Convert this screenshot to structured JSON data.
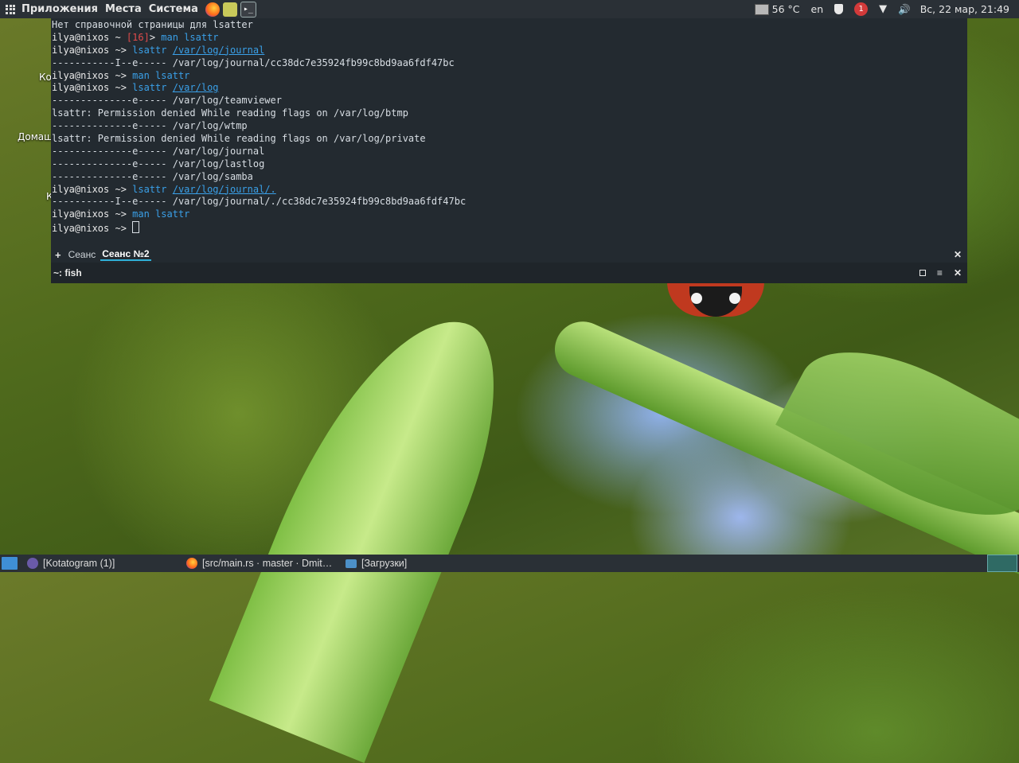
{
  "top_panel": {
    "menus": [
      "Приложения",
      "Места",
      "Система"
    ],
    "temperature": "56 °C",
    "keyboard_layout": "en",
    "notification_count": "1",
    "clock": "Вс, 22 мар, 21:49",
    "terminal_launcher_glyph": "▸_"
  },
  "desktop_labels": [
    "Ко",
    "Домаш",
    "К"
  ],
  "terminal": {
    "lines": [
      {
        "segments": [
          {
            "t": "Нет справочной страницы для lsatter",
            "c": ""
          }
        ]
      },
      {
        "segments": [
          {
            "t": "ilya@nixos ~ ",
            "c": "c-prompt"
          },
          {
            "t": "[16]",
            "c": "c-red"
          },
          {
            "t": "> ",
            "c": "c-prompt"
          },
          {
            "t": "man lsattr",
            "c": "c-cmd"
          }
        ]
      },
      {
        "segments": [
          {
            "t": "ilya@nixos ~> ",
            "c": "c-prompt"
          },
          {
            "t": "lsattr ",
            "c": "c-cmd"
          },
          {
            "t": "/var/log/journal",
            "c": "c-path"
          }
        ]
      },
      {
        "segments": [
          {
            "t": "-----------I--e----- /var/log/journal/cc38dc7e35924fb99c8bd9aa6fdf47bc",
            "c": ""
          }
        ]
      },
      {
        "segments": [
          {
            "t": "ilya@nixos ~> ",
            "c": "c-prompt"
          },
          {
            "t": "man lsattr",
            "c": "c-cmd"
          }
        ]
      },
      {
        "segments": [
          {
            "t": "ilya@nixos ~> ",
            "c": "c-prompt"
          },
          {
            "t": "lsattr ",
            "c": "c-cmd"
          },
          {
            "t": "/var/log",
            "c": "c-path"
          }
        ]
      },
      {
        "segments": [
          {
            "t": "--------------e----- /var/log/teamviewer",
            "c": ""
          }
        ]
      },
      {
        "segments": [
          {
            "t": "lsattr: Permission denied While reading flags on /var/log/btmp",
            "c": ""
          }
        ]
      },
      {
        "segments": [
          {
            "t": "--------------e----- /var/log/wtmp",
            "c": ""
          }
        ]
      },
      {
        "segments": [
          {
            "t": "lsattr: Permission denied While reading flags on /var/log/private",
            "c": ""
          }
        ]
      },
      {
        "segments": [
          {
            "t": "--------------e----- /var/log/journal",
            "c": ""
          }
        ]
      },
      {
        "segments": [
          {
            "t": "--------------e----- /var/log/lastlog",
            "c": ""
          }
        ]
      },
      {
        "segments": [
          {
            "t": "--------------e----- /var/log/samba",
            "c": ""
          }
        ]
      },
      {
        "segments": [
          {
            "t": "ilya@nixos ~> ",
            "c": "c-prompt"
          },
          {
            "t": "lsattr ",
            "c": "c-cmd"
          },
          {
            "t": "/var/log/journal/.",
            "c": "c-path"
          }
        ]
      },
      {
        "segments": [
          {
            "t": "-----------I--e----- /var/log/journal/./cc38dc7e35924fb99c8bd9aa6fdf47bc",
            "c": ""
          }
        ]
      },
      {
        "segments": [
          {
            "t": "ilya@nixos ~> ",
            "c": "c-prompt"
          },
          {
            "t": "man lsattr",
            "c": "c-cmd"
          }
        ]
      },
      {
        "segments": [
          {
            "t": "ilya@nixos ~> ",
            "c": "c-prompt"
          }
        ],
        "cursor": true
      }
    ],
    "tab_add": "+",
    "tabs": [
      {
        "label": "Сеанс",
        "active": false
      },
      {
        "label": "Сеанс №2",
        "active": true
      }
    ],
    "tab_close": "✕",
    "status_title": "~: fish",
    "ctrl_menu": "≡",
    "ctrl_close": "✕"
  },
  "taskbar": {
    "tasks": [
      {
        "label": "[Kotatogram (1)]",
        "icon": "kotatogram-icon"
      },
      {
        "label": "[src/main.rs · master · Dmit…",
        "icon": "firefox-icon"
      },
      {
        "label": "[Загрузки]",
        "icon": "folder-icon"
      }
    ]
  }
}
